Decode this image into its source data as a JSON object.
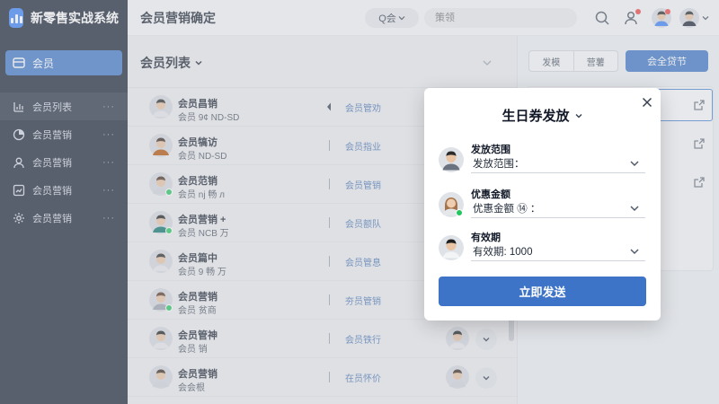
{
  "app": {
    "title": "新零售实战系统"
  },
  "sidebar": {
    "active": {
      "label": "会员",
      "icon": "member-card-icon"
    },
    "items": [
      {
        "label": "会员列表",
        "icon": "bar-chart-icon"
      },
      {
        "label": "会员营销",
        "icon": "pie-chart-icon"
      },
      {
        "label": "会员营销",
        "icon": "user-icon"
      },
      {
        "label": "会员营销",
        "icon": "trend-chart-icon"
      },
      {
        "label": "会员营销",
        "icon": "gear-icon"
      }
    ],
    "more": "···"
  },
  "topbar": {
    "title": "会员营销确定",
    "search_select": "Q会",
    "search_placeholder": "策领"
  },
  "main": {
    "heading": "会员列表",
    "rows": [
      {
        "name": "会员昌销",
        "sub": "会员 9¢ ND-SD",
        "tag": "会员管劝",
        "marker": "arrow"
      },
      {
        "name": "会员犒访",
        "sub": "会员 ND-SD",
        "tag": "会员指业",
        "marker": "bar"
      },
      {
        "name": "会员范销",
        "sub": "会员 nj 畅 л",
        "tag": "会员管销",
        "marker": "bar"
      },
      {
        "name": "会员营销 +",
        "sub": "会员 NCB 万",
        "tag": "会员额队",
        "marker": "bar"
      },
      {
        "name": "会员篇中",
        "sub": "会员 9 畅 万",
        "tag": "会员管息",
        "marker": "bar"
      },
      {
        "name": "会员营销",
        "sub": "会员 贫商",
        "tag": "夯员管销",
        "marker": "bar"
      },
      {
        "name": "会员管神",
        "sub": "会员 销",
        "tag": "会员铁行",
        "marker": "bar"
      },
      {
        "name": "会员营销",
        "sub": "会会根",
        "tag": "在员怀价",
        "marker": "bar"
      }
    ]
  },
  "right_panel": {
    "tabs": [
      "发模",
      "营薯"
    ],
    "primary_button": "会全贷节"
  },
  "modal": {
    "title": "生日券发放",
    "fields": [
      {
        "label": "发放范围",
        "value": "发放范围："
      },
      {
        "label": "优惠金额",
        "value": "优惠金额 ⑭ ："
      },
      {
        "label": "有效期",
        "value": "有效期: 1000"
      }
    ],
    "submit": "立即发送"
  },
  "colors": {
    "sidebar_bg": "#1e2738",
    "accent": "#3e76c6",
    "online": "#22c55e"
  }
}
